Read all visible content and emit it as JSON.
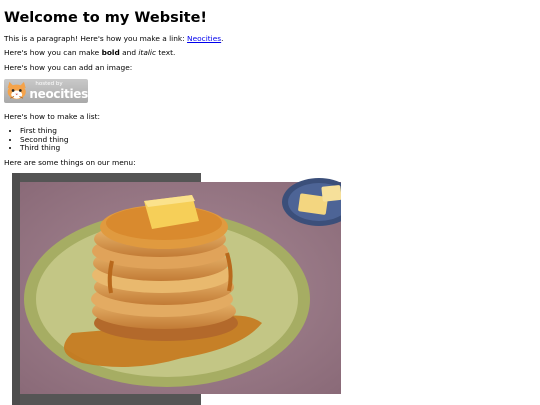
{
  "page": {
    "title": "Welcome to my Website!",
    "para1": {
      "text": "This is a paragraph! Here's how you make a link: ",
      "link_text": "Neocities",
      "after": "."
    },
    "para2": {
      "before": "Here's how you can make ",
      "bold": "bold",
      "middle": " and ",
      "italic": "italic",
      "after": " text."
    },
    "para3": "Here's how you can add an image:",
    "badge": {
      "line1": "hosted by",
      "line2": "neocities",
      "icon": "neocities-cat-icon"
    },
    "para4": "Here's how to make a list:",
    "list": [
      "First thing",
      "Second thing",
      "Third thing"
    ],
    "para5": "Here are some things on our menu:",
    "menu_image": {
      "subject": "stack of pancakes with butter and syrup"
    }
  }
}
